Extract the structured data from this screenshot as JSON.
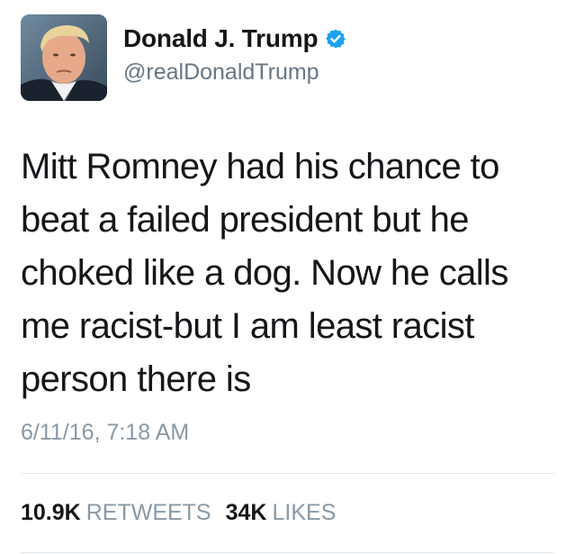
{
  "author": {
    "display_name": "Donald J. Trump",
    "handle": "@realDonaldTrump",
    "verified": true,
    "verified_color": "#1da1f2"
  },
  "tweet": {
    "lines": [
      "Mitt Romney had his chance to",
      "beat a failed president but he",
      "choked like a dog. Now he calls",
      "me racist-but I am least racist",
      "person there is"
    ],
    "timestamp": "6/11/16, 7:18 AM"
  },
  "stats": {
    "retweets_count": "10.9K",
    "retweets_label": "RETWEETS",
    "likes_count": "34K",
    "likes_label": "LIKES"
  }
}
